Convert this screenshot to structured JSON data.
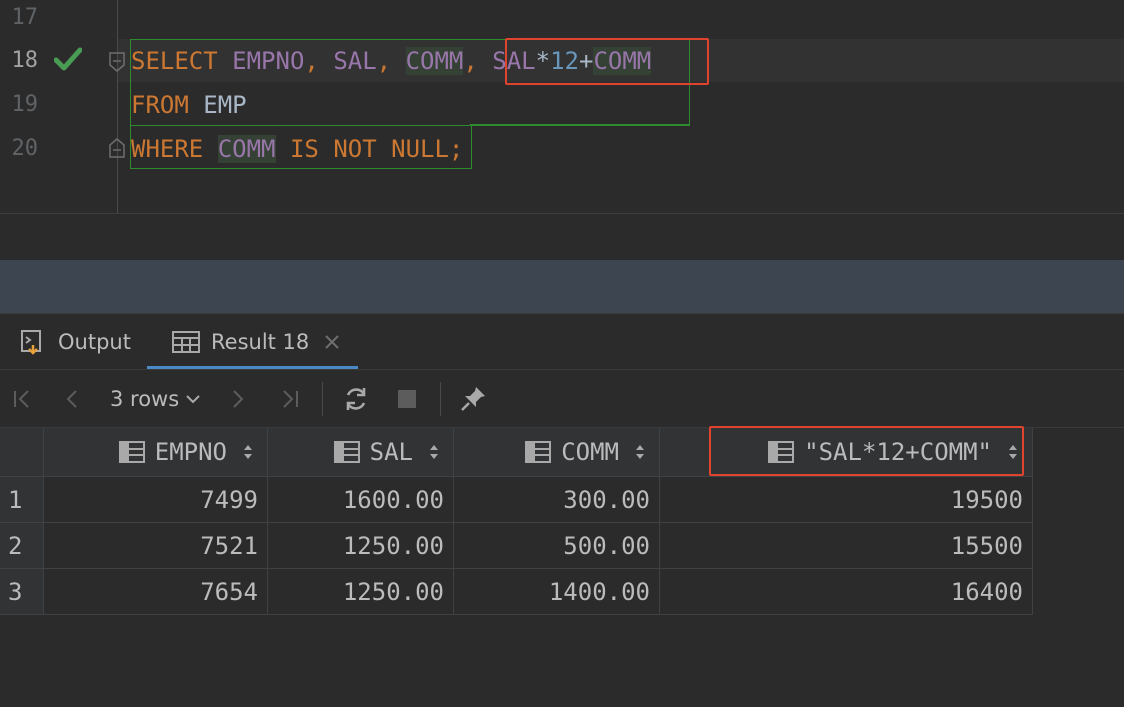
{
  "editor": {
    "line_numbers": [
      "17",
      "18",
      "19",
      "20"
    ],
    "status_icon": "green-check-icon",
    "lines": {
      "l18": {
        "kw1": "SELECT",
        "c1": "EMPNO",
        "p1": ",",
        "c2": "SAL",
        "p2": ",",
        "c3": "COMM",
        "p3": ",",
        "e1": "SAL",
        "op1": "*",
        "n1": "12",
        "op2": "+",
        "e2": "COMM"
      },
      "l19": {
        "kw1": "FROM",
        "t1": "EMP"
      },
      "l20": {
        "kw1": "WHERE",
        "c1": "COMM",
        "kw2": "IS",
        "kw3": "NOT",
        "kw4": "NULL",
        "p1": ";"
      }
    }
  },
  "tabs": {
    "output_label": "Output",
    "result_label": "Result 18"
  },
  "toolbar": {
    "rows_label": "3 rows"
  },
  "grid": {
    "columns": [
      "EMPNO",
      "SAL",
      "COMM",
      "\"SAL*12+COMM\""
    ],
    "row_numbers": [
      "1",
      "2",
      "3"
    ],
    "rows": [
      [
        "7499",
        "1600.00",
        "300.00",
        "19500"
      ],
      [
        "7521",
        "1250.00",
        "500.00",
        "15500"
      ],
      [
        "7654",
        "1250.00",
        "1400.00",
        "16400"
      ]
    ]
  },
  "colors": {
    "keyword": "#cc7832",
    "identifier": "#9876aa",
    "number": "#6897bb",
    "highlight_box": "#e0432e",
    "scope_box": "#2f8b2f",
    "tab_accent": "#4a88c7"
  }
}
